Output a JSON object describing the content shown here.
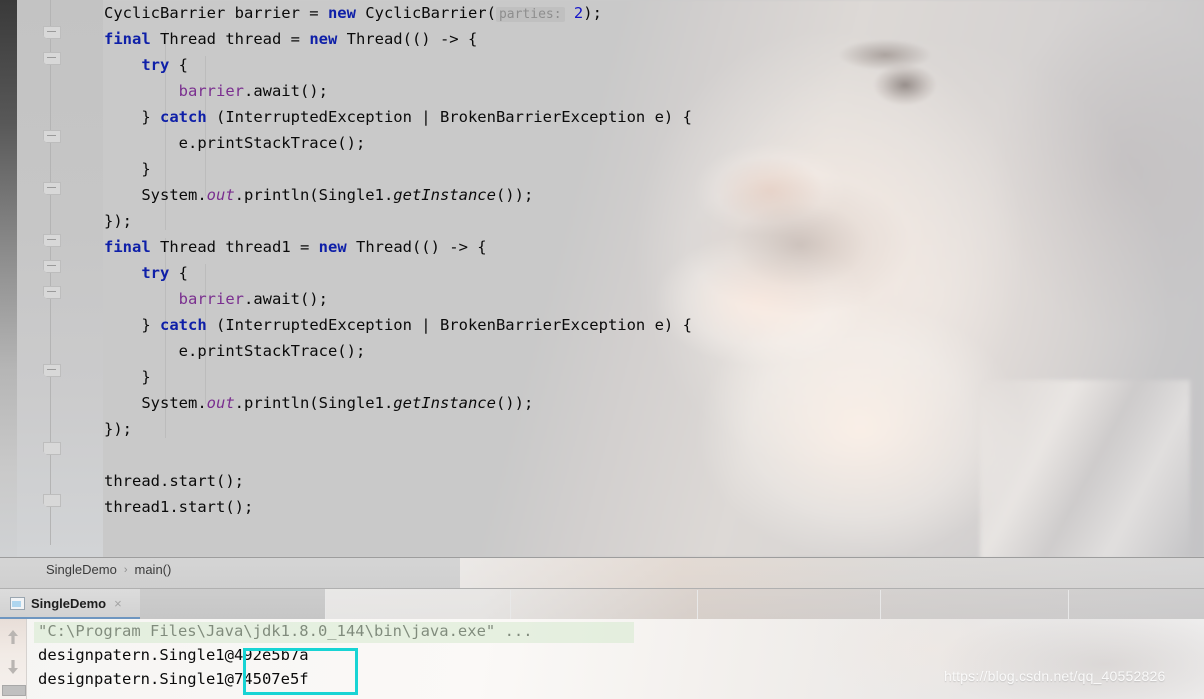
{
  "editor": {
    "name": "java-code-editor",
    "language": "Java",
    "lines": [
      {
        "indent": 0,
        "tokens": [
          {
            "t": "CyclicBarrier barrier = ",
            "c": "plain"
          },
          {
            "t": "new",
            "c": "kw"
          },
          {
            "t": " CyclicBarrier(",
            "c": "plain"
          },
          {
            "t": "parties:",
            "c": "hint"
          },
          {
            "t": " ",
            "c": "plain"
          },
          {
            "t": "2",
            "c": "num"
          },
          {
            "t": ");",
            "c": "plain"
          }
        ]
      },
      {
        "indent": 0,
        "tokens": [
          {
            "t": "final",
            "c": "kw"
          },
          {
            "t": " Thread thread = ",
            "c": "plain"
          },
          {
            "t": "new",
            "c": "kw"
          },
          {
            "t": " Thread(() -> {",
            "c": "plain"
          }
        ]
      },
      {
        "indent": 0,
        "tokens": [
          {
            "t": "    ",
            "c": "plain"
          },
          {
            "t": "try",
            "c": "kw"
          },
          {
            "t": " {",
            "c": "plain"
          }
        ]
      },
      {
        "indent": 0,
        "tokens": [
          {
            "t": "        ",
            "c": "plain"
          },
          {
            "t": "barrier",
            "c": "fld"
          },
          {
            "t": ".await();",
            "c": "plain"
          }
        ]
      },
      {
        "indent": 0,
        "tokens": [
          {
            "t": "    } ",
            "c": "plain"
          },
          {
            "t": "catch",
            "c": "kw"
          },
          {
            "t": " (InterruptedException | BrokenBarrierException e) {",
            "c": "plain"
          }
        ]
      },
      {
        "indent": 0,
        "tokens": [
          {
            "t": "        e.printStackTrace();",
            "c": "plain"
          }
        ]
      },
      {
        "indent": 0,
        "tokens": [
          {
            "t": "    }",
            "c": "plain"
          }
        ]
      },
      {
        "indent": 0,
        "tokens": [
          {
            "t": "    System.",
            "c": "plain"
          },
          {
            "t": "out",
            "c": "fldi"
          },
          {
            "t": ".println(Single1.",
            "c": "plain"
          },
          {
            "t": "getInstance",
            "c": "ital"
          },
          {
            "t": "());",
            "c": "plain"
          }
        ]
      },
      {
        "indent": 0,
        "tokens": [
          {
            "t": "});",
            "c": "plain"
          }
        ]
      },
      {
        "indent": 0,
        "tokens": [
          {
            "t": "final",
            "c": "kw"
          },
          {
            "t": " Thread thread1 = ",
            "c": "plain"
          },
          {
            "t": "new",
            "c": "kw"
          },
          {
            "t": " Thread(() -> {",
            "c": "plain"
          }
        ]
      },
      {
        "indent": 0,
        "tokens": [
          {
            "t": "    ",
            "c": "plain"
          },
          {
            "t": "try",
            "c": "kw"
          },
          {
            "t": " {",
            "c": "plain"
          }
        ]
      },
      {
        "indent": 0,
        "tokens": [
          {
            "t": "        ",
            "c": "plain"
          },
          {
            "t": "barrier",
            "c": "fld"
          },
          {
            "t": ".await();",
            "c": "plain"
          }
        ]
      },
      {
        "indent": 0,
        "tokens": [
          {
            "t": "    } ",
            "c": "plain"
          },
          {
            "t": "catch",
            "c": "kw"
          },
          {
            "t": " (InterruptedException | BrokenBarrierException e) {",
            "c": "plain"
          }
        ]
      },
      {
        "indent": 0,
        "tokens": [
          {
            "t": "        e.printStackTrace();",
            "c": "plain"
          }
        ]
      },
      {
        "indent": 0,
        "tokens": [
          {
            "t": "    }",
            "c": "plain"
          }
        ]
      },
      {
        "indent": 0,
        "tokens": [
          {
            "t": "    System.",
            "c": "plain"
          },
          {
            "t": "out",
            "c": "fldi"
          },
          {
            "t": ".println(Single1.",
            "c": "plain"
          },
          {
            "t": "getInstance",
            "c": "ital"
          },
          {
            "t": "());",
            "c": "plain"
          }
        ]
      },
      {
        "indent": 0,
        "tokens": [
          {
            "t": "});",
            "c": "plain"
          }
        ]
      },
      {
        "indent": 0,
        "tokens": []
      },
      {
        "indent": 0,
        "tokens": [
          {
            "t": "thread.start();",
            "c": "plain"
          }
        ]
      },
      {
        "indent": 0,
        "tokens": [
          {
            "t": "thread1.start();",
            "c": "plain"
          }
        ]
      }
    ],
    "fold_marker_tops": [
      26,
      52,
      130,
      182,
      234,
      260,
      286,
      364,
      442,
      494
    ],
    "colors": {
      "keyword": "#0e1fa8",
      "field": "#7a2f8f",
      "number": "#1414c8",
      "hint_text": "#8e8e8e",
      "plain": "#0a0a0a"
    }
  },
  "breadcrumb": {
    "items": [
      "SingleDemo",
      "main()"
    ],
    "separator": "›"
  },
  "tabs": [
    {
      "label": "SingleDemo",
      "close": "×",
      "active": true
    }
  ],
  "console": {
    "lines": [
      "\"C:\\Program Files\\Java\\jdk1.8.0_144\\bin\\java.exe\" ...",
      "designpatern.Single1@492e5b7a",
      "designpatern.Single1@74507e5f"
    ],
    "highlight_box_color": "#18d4d4",
    "toolbar": {
      "up_label": "Up the stack trace",
      "down_label": "Down the stack trace"
    }
  },
  "watermark": {
    "text": "https://blog.csdn.net/qq_40552826"
  }
}
